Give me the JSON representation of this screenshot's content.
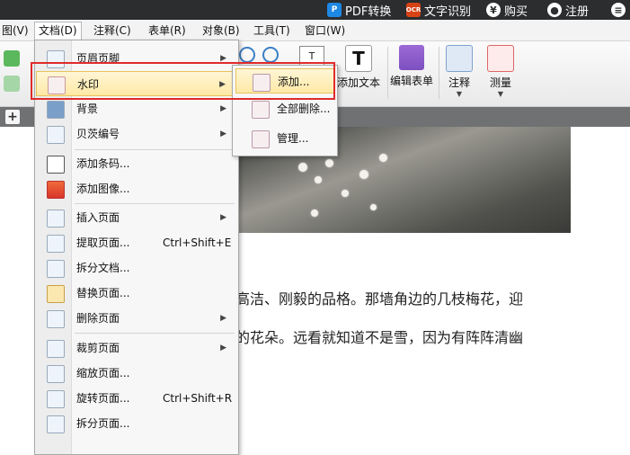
{
  "topbar": {
    "pdf_label": "PDF转换",
    "ocr_badge": "OCR",
    "ocr_label": "文字识别",
    "buy_symbol": "¥",
    "buy_label": "购买",
    "register_label": "注册"
  },
  "menubar": {
    "items": [
      "图(V)",
      "文档(D)",
      "注释(C)",
      "表单(R)",
      "对象(B)",
      "工具(T)",
      "窗口(W)"
    ]
  },
  "toolbar": {
    "add_text": "添加文本",
    "edit_form": "编辑表单",
    "annotate": "注释",
    "measure": "测量",
    "text_tool_glyph": "T"
  },
  "tabstrip": {
    "add_symbol": "+"
  },
  "document_menu": {
    "arrow": "▶",
    "items": [
      {
        "label": "页眉页脚",
        "shortcut": ""
      },
      {
        "label": "水印",
        "shortcut": ""
      },
      {
        "label": "背景",
        "shortcut": ""
      },
      {
        "label": "贝茨编号",
        "shortcut": ""
      },
      {
        "label": "添加条码...",
        "shortcut": ""
      },
      {
        "label": "添加图像...",
        "shortcut": ""
      },
      {
        "label": "插入页面",
        "shortcut": ""
      },
      {
        "label": "提取页面...",
        "shortcut": "Ctrl+Shift+E"
      },
      {
        "label": "拆分文档...",
        "shortcut": ""
      },
      {
        "label": "替换页面...",
        "shortcut": ""
      },
      {
        "label": "删除页面",
        "shortcut": ""
      },
      {
        "label": "裁剪页面",
        "shortcut": ""
      },
      {
        "label": "缩放页面...",
        "shortcut": ""
      },
      {
        "label": "旋转页面...",
        "shortcut": "Ctrl+Shift+R"
      },
      {
        "label": "拆分页面...",
        "shortcut": ""
      }
    ]
  },
  "watermark_submenu": {
    "items": [
      "添加...",
      "全部删除...",
      "管理..."
    ]
  },
  "document": {
    "line1": "高洁、刚毅的品格。那墙角边的几枝梅花，迎",
    "line2": "的花朵。远看就知道不是雪，因为有阵阵清幽"
  },
  "colors": {
    "highlight_border": "#e02a2a",
    "menu_hover": "#ffe9a6",
    "topbar_bg": "#2b2d2f"
  }
}
